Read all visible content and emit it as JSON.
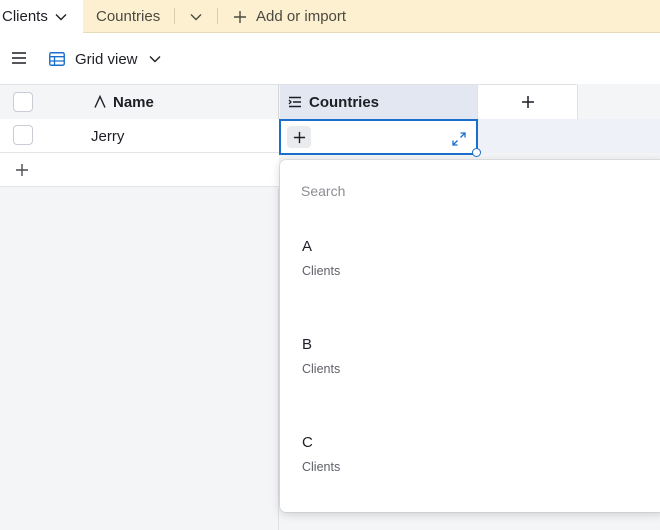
{
  "tabs": {
    "active": "Clients",
    "other": "Countries",
    "add_or_import": "Add or import"
  },
  "view": {
    "name": "Grid view"
  },
  "columns": {
    "name": "Name",
    "countries": "Countries"
  },
  "rows": [
    {
      "name": "Jerry",
      "countries": ""
    }
  ],
  "picker": {
    "search_placeholder": "Search",
    "options": [
      {
        "title": "A",
        "table": "Clients"
      },
      {
        "title": "B",
        "table": "Clients"
      },
      {
        "title": "C",
        "table": "Clients"
      }
    ]
  },
  "colors": {
    "accent": "#1a6fcc",
    "tabbar_bg": "#fcf0d1",
    "selected_header_bg": "#e3e7f1"
  }
}
